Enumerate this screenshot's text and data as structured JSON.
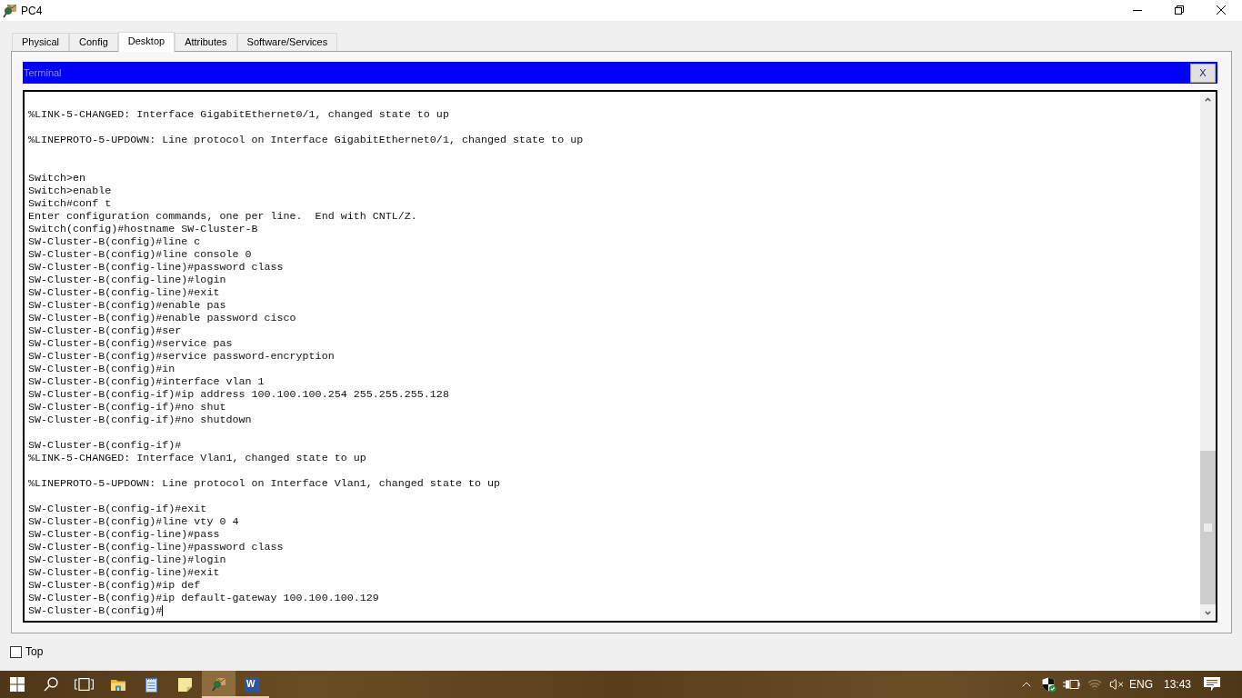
{
  "window": {
    "title": "PC4"
  },
  "tabs": [
    {
      "label": "Physical",
      "selected": false
    },
    {
      "label": "Config",
      "selected": false
    },
    {
      "label": "Desktop",
      "selected": true
    },
    {
      "label": "Attributes",
      "selected": false
    },
    {
      "label": "Software/Services",
      "selected": false
    }
  ],
  "terminal": {
    "title": "Terminal",
    "close_label": "X",
    "lines": [
      {
        "kind": "blank"
      },
      {
        "kind": "output",
        "text": "%LINK-5-CHANGED: Interface GigabitEthernet0/1, changed state to up"
      },
      {
        "kind": "blank"
      },
      {
        "kind": "output",
        "text": "%LINEPROTO-5-UPDOWN: Line protocol on Interface GigabitEthernet0/1, changed state to up"
      },
      {
        "kind": "blank"
      },
      {
        "kind": "blank"
      },
      {
        "kind": "output",
        "text": "Switch>en"
      },
      {
        "kind": "output",
        "text": "Switch>enable"
      },
      {
        "kind": "output",
        "text": "Switch#conf t"
      },
      {
        "kind": "output",
        "text": "Enter configuration commands, one per line.  End with CNTL/Z."
      },
      {
        "kind": "output",
        "text": "Switch(config)#hostname SW-Cluster-B"
      },
      {
        "kind": "output",
        "text": "SW-Cluster-B(config)#line c"
      },
      {
        "kind": "output",
        "text": "SW-Cluster-B(config)#line console 0"
      },
      {
        "kind": "output",
        "text": "SW-Cluster-B(config-line)#password class"
      },
      {
        "kind": "output",
        "text": "SW-Cluster-B(config-line)#login"
      },
      {
        "kind": "output",
        "text": "SW-Cluster-B(config-line)#exit"
      },
      {
        "kind": "output",
        "text": "SW-Cluster-B(config)#enable pas"
      },
      {
        "kind": "output",
        "text": "SW-Cluster-B(config)#enable password cisco"
      },
      {
        "kind": "output",
        "text": "SW-Cluster-B(config)#ser"
      },
      {
        "kind": "output",
        "text": "SW-Cluster-B(config)#service pas"
      },
      {
        "kind": "output",
        "text": "SW-Cluster-B(config)#service password-encryption"
      },
      {
        "kind": "output",
        "text": "SW-Cluster-B(config)#in"
      },
      {
        "kind": "output",
        "text": "SW-Cluster-B(config)#interface vlan 1"
      },
      {
        "kind": "output",
        "text": "SW-Cluster-B(config-if)#ip address 100.100.100.254 255.255.255.128"
      },
      {
        "kind": "output",
        "text": "SW-Cluster-B(config-if)#no shut"
      },
      {
        "kind": "output",
        "text": "SW-Cluster-B(config-if)#no shutdown"
      },
      {
        "kind": "blank"
      },
      {
        "kind": "output",
        "text": "SW-Cluster-B(config-if)#"
      },
      {
        "kind": "output",
        "text": "%LINK-5-CHANGED: Interface Vlan1, changed state to up"
      },
      {
        "kind": "blank"
      },
      {
        "kind": "output",
        "text": "%LINEPROTO-5-UPDOWN: Line protocol on Interface Vlan1, changed state to up"
      },
      {
        "kind": "blank"
      },
      {
        "kind": "output",
        "text": "SW-Cluster-B(config-if)#exit"
      },
      {
        "kind": "output",
        "text": "SW-Cluster-B(config)#line vty 0 4"
      },
      {
        "kind": "output",
        "text": "SW-Cluster-B(config-line)#pass"
      },
      {
        "kind": "output",
        "text": "SW-Cluster-B(config-line)#password class"
      },
      {
        "kind": "output",
        "text": "SW-Cluster-B(config-line)#login"
      },
      {
        "kind": "output",
        "text": "SW-Cluster-B(config-line)#exit"
      },
      {
        "kind": "output",
        "text": "SW-Cluster-B(config)#ip def"
      },
      {
        "kind": "output",
        "text": "SW-Cluster-B(config)#ip default-gateway 100.100.100.129"
      },
      {
        "kind": "output",
        "text": "SW-Cluster-B(config)#"
      }
    ]
  },
  "top_checkbox": {
    "label": "Top",
    "checked": false
  },
  "taskbar": {
    "apps": [
      {
        "running": false,
        "active": false
      },
      {
        "running": false,
        "active": false
      },
      {
        "running": false,
        "active": false
      },
      {
        "running": true,
        "active": true
      },
      {
        "running": true,
        "active": false,
        "logo_text": "W"
      }
    ],
    "language": "ENG",
    "time": "13:43"
  }
}
